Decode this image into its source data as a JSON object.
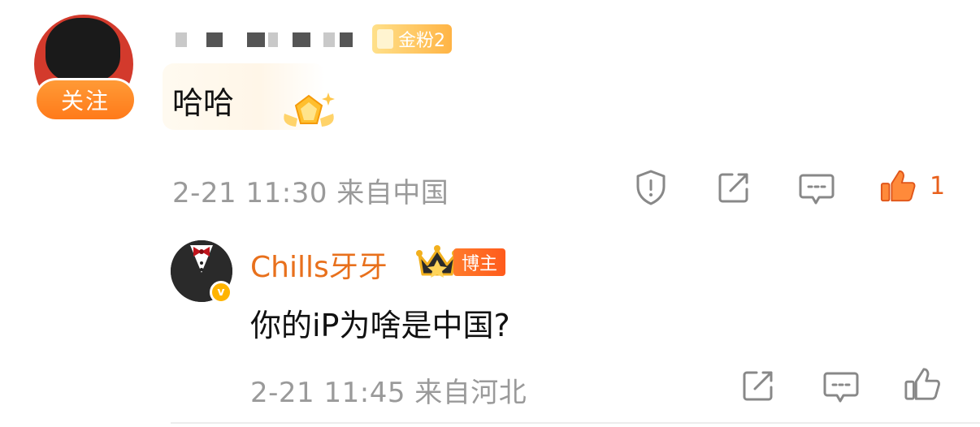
{
  "comment": {
    "follow_label": "关注",
    "fan_badge_label": "金粉2",
    "text": "哈哈",
    "time": "2-21 11:30",
    "location": "来自中国",
    "like_count": "1",
    "colors": {
      "accent": "#e8601c",
      "follow": "#ff8a26",
      "meta": "#9a9a9a"
    }
  },
  "reply": {
    "author": "Chills牙牙",
    "host_badge_label": "博主",
    "verified_mark": "v",
    "text": "你的iP为啥是中国?",
    "time": "2-21 11:45",
    "location": "来自河北"
  },
  "icons": {
    "report": "shield-alert-icon",
    "repost": "share-square-icon",
    "comment": "comment-bubble-icon",
    "like": "thumbs-up-icon"
  }
}
